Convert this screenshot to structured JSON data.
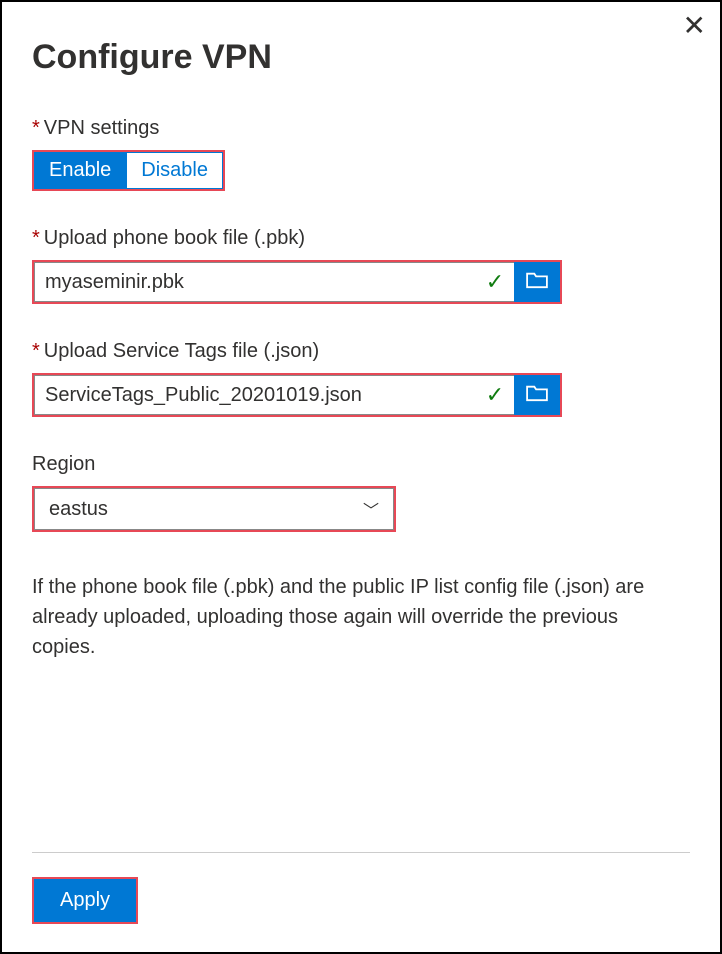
{
  "header": {
    "title": "Configure VPN"
  },
  "fields": {
    "vpn": {
      "label": "VPN settings",
      "enable": "Enable",
      "disable": "Disable"
    },
    "pbk": {
      "label": "Upload phone book file (.pbk)",
      "value": "myaseminir.pbk"
    },
    "tags": {
      "label": "Upload Service Tags file (.json)",
      "value": "ServiceTags_Public_20201019.json"
    },
    "region": {
      "label": "Region",
      "value": "eastus"
    }
  },
  "note": "If the phone book file (.pbk) and the public IP list config file (.json) are already uploaded, uploading those again will override the previous copies.",
  "footer": {
    "apply": "Apply"
  },
  "icons": {
    "check": "✓",
    "chevron": "﹀"
  }
}
